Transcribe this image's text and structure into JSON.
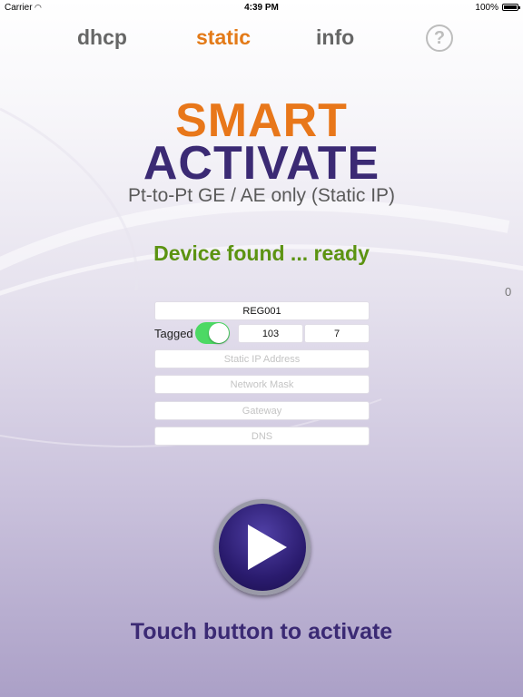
{
  "status_bar": {
    "carrier": "Carrier",
    "time": "4:39 PM",
    "battery": "100%"
  },
  "tabs": {
    "dhcp": "dhcp",
    "static": "static",
    "info": "info",
    "help_glyph": "?"
  },
  "logo": {
    "line1": "SMART",
    "line2": "ACTIVATE"
  },
  "subtitle": "Pt-to-Pt GE / AE only (Static IP)",
  "device_status": "Device found ... ready",
  "side_count": "0",
  "form": {
    "registration": "REG001",
    "tagged_label": "Tagged",
    "tagged_on": true,
    "vlan_id": "103",
    "vlan_priority": "7",
    "static_ip_placeholder": "Static IP Address",
    "netmask_placeholder": "Network Mask",
    "gateway_placeholder": "Gateway",
    "dns_placeholder": "DNS"
  },
  "cta": "Touch button to activate",
  "colors": {
    "accent_orange": "#e8771a",
    "brand_purple": "#3b2a74",
    "status_green": "#5c9312",
    "toggle_green": "#4cd964"
  },
  "icons": {
    "wifi": "wifi-icon",
    "battery": "battery-icon",
    "help": "question-mark-icon",
    "play": "play-icon"
  }
}
